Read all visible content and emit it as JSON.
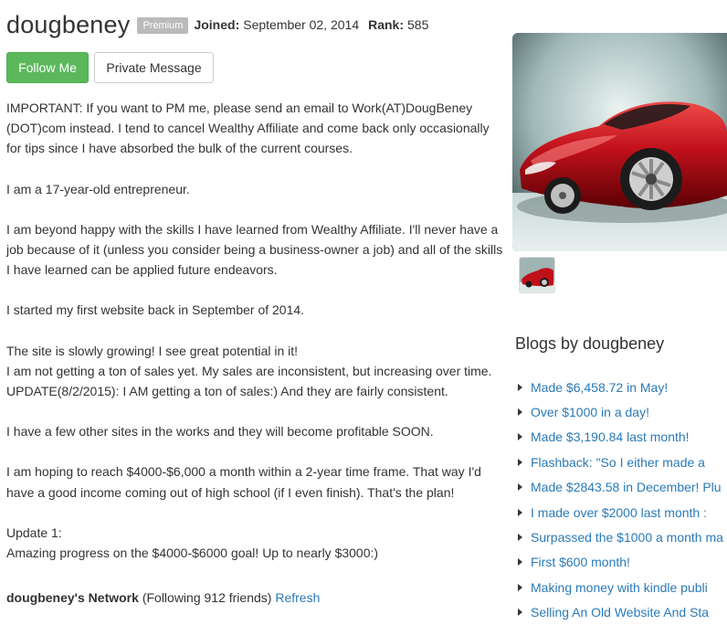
{
  "profile": {
    "username": "dougbeney",
    "badge": "Premium",
    "joined_label": "Joined:",
    "joined_value": "September 02, 2014",
    "rank_label": "Rank:",
    "rank_value": "585"
  },
  "actions": {
    "follow_label": "Follow Me",
    "pm_label": "Private Message"
  },
  "bio": [
    "IMPORTANT: If you want to PM me, please send an email to Work(AT)DougBeney (DOT)com instead. I tend to cancel Wealthy Affiliate and come back only occasionally for tips since I have absorbed the bulk of the current courses.",
    "",
    "I am a 17-year-old entrepreneur.",
    "",
    "I am beyond happy with the skills I have learned from Wealthy Affiliate. I'll never have a job because of it (unless you consider being a business-owner a job) and all of the skills I have learned can be applied future endeavors.",
    "",
    "I started my first website back in September of 2014.",
    "",
    "The site is slowly growing! I see great potential in it!",
    "I am not getting a ton of sales yet. My sales are inconsistent, but increasing over time.",
    "UPDATE(8/2/2015): I AM getting a ton of sales:) And they are fairly consistent.",
    "",
    "I have a few other sites in the works and they will become profitable SOON.",
    "",
    "I am hoping to reach $4000-$6,000 a month within a 2-year time frame. That way I'd have a good income coming out of high school (if I even finish). That's the plan!",
    "",
    "Update 1:",
    "Amazing progress on the $4000-$6000 goal! Up to nearly $3000:)"
  ],
  "network": {
    "title": "dougbeney's Network",
    "following": "(Following 912 friends)",
    "refresh_label": "Refresh"
  },
  "sidebar": {
    "blogs_title": "Blogs by dougbeney",
    "blogs": [
      "Made $6,458.72 in May!",
      "Over $1000 in a day!",
      "Made $3,190.84 last month!",
      "Flashback: \"So I either made a",
      "Made $2843.58 in December! Plu",
      "I made over $2000 last month :",
      "Surpassed the $1000 a month ma",
      "First $600 month!",
      "Making money with kindle publi",
      "Selling An Old Website And Sta"
    ]
  },
  "colors": {
    "accent_link": "#2a7ab8",
    "follow_button": "#5cb85c",
    "badge": "#bbbbbb",
    "car_red": "#c0101a"
  }
}
